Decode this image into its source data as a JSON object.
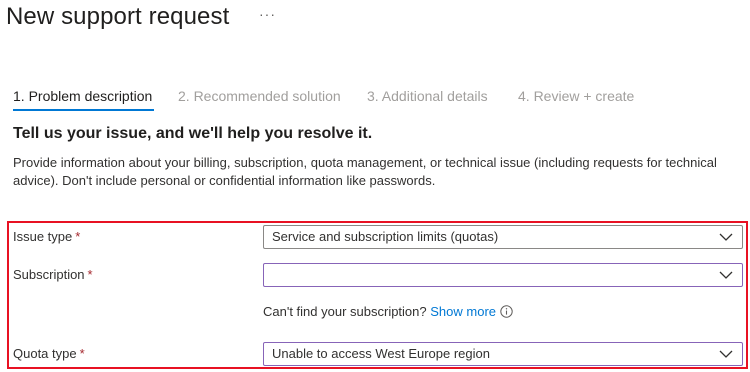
{
  "page": {
    "title": "New support request",
    "more_label": "···"
  },
  "tabs": [
    {
      "label": "1. Problem description",
      "state": "active"
    },
    {
      "label": "2. Recommended solution",
      "state": "inactive"
    },
    {
      "label": "3. Additional details",
      "state": "inactive"
    },
    {
      "label": "4. Review + create",
      "state": "inactive"
    }
  ],
  "intro": {
    "heading": "Tell us your issue, and we'll help you resolve it.",
    "description": "Provide information about your billing, subscription, quota management, or technical issue (including requests for technical advice). Don't include personal or confidential information like passwords."
  },
  "form": {
    "required_marker": "*",
    "issue_type": {
      "label": "Issue type",
      "value": "Service and subscription limits (quotas)"
    },
    "subscription": {
      "label": "Subscription",
      "value": ""
    },
    "subscription_help": {
      "text": "Can't find your subscription?",
      "link": "Show more"
    },
    "quota_type": {
      "label": "Quota type",
      "value": "Unable to access West Europe region"
    }
  },
  "colors": {
    "accent": "#0078d4",
    "highlight": "#e81123",
    "required": "#a4262c",
    "focus": "#8764b8"
  },
  "icons": {
    "dropdown": "chevron-down-icon",
    "info": "info-icon",
    "more": "more-horizontal-icon"
  }
}
